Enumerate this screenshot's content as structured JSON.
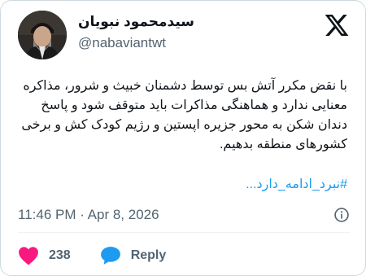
{
  "user": {
    "display_name": "سیدمحمود نبویان",
    "handle": "@nabaviantwt"
  },
  "tweet": {
    "text": "با نقض مکرر آتش بس توسط دشمنان خبیث و شرور، مذاکره معنایی ندارد و هماهنگی مذاکرات باید متوقف شود و پاسخ دندان شکن به محور جزیره اپستین و رژیم کودک کش و برخی کشورهای منطقه بدهیم.",
    "hashtag": "#نبرد_ادامه_دارد",
    "hashtag_suffix": "..."
  },
  "meta": {
    "timestamp": "11:46 PM · Apr 8, 2026"
  },
  "actions": {
    "like_count": "238",
    "reply_label": "Reply"
  },
  "icons": {
    "logo": "x-logo-icon",
    "info": "info-icon",
    "like": "heart-icon",
    "reply": "speech-bubble-icon"
  },
  "colors": {
    "link": "#1d9bf0",
    "like": "#f91880",
    "secondary_text": "#536471"
  }
}
